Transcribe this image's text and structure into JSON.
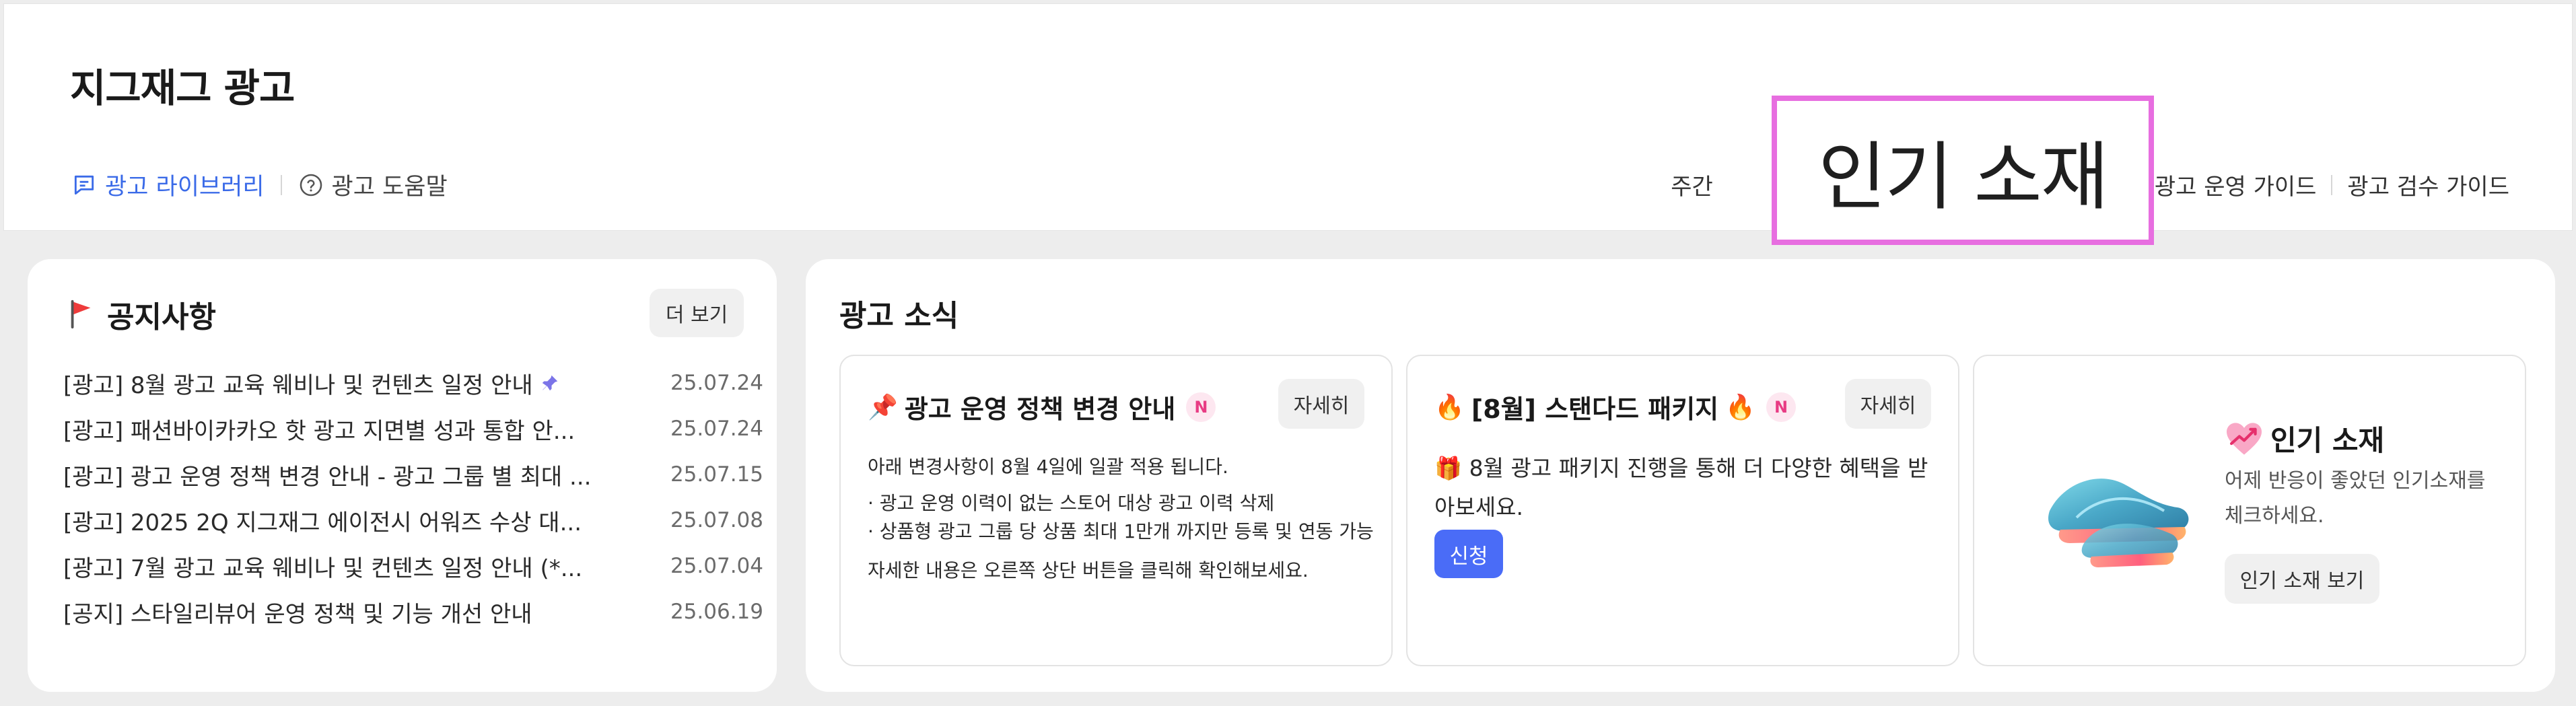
{
  "header": {
    "title": "지그재그 광고",
    "left_links": [
      {
        "label": "광고 라이브러리",
        "icon": "chat-list-icon"
      },
      {
        "label": "광고 도움말",
        "icon": "help-circle-icon"
      }
    ],
    "right_links": [
      "주간",
      "광고 운영 가이드",
      "광고 검수 가이드"
    ]
  },
  "overlay": {
    "label": "인기 소재"
  },
  "notice": {
    "title": "공지사항",
    "more_label": "더 보기",
    "items": [
      {
        "title": "[광고] 8월 광고 교육 웨비나 및 컨텐츠 일정 안내",
        "date": "25.07.24",
        "pinned": true
      },
      {
        "title": "[광고] 패션바이카카오 핫 광고 지면별 성과 통합 안...",
        "date": "25.07.24"
      },
      {
        "title": "[광고] 광고 운영 정책 변경 안내 - 광고 그룹 별 최대 ...",
        "date": "25.07.15"
      },
      {
        "title": "[광고] 2025 2Q 지그재그 에이전시 어워즈 수상 대...",
        "date": "25.07.08"
      },
      {
        "title": "[광고] 7월 광고 교육 웨비나 및 컨텐츠 일정 안내 (*...",
        "date": "25.07.04"
      },
      {
        "title": "[공지] 스타일리뷰어 운영 정책 및 기능 개선 안내",
        "date": "25.06.19"
      }
    ]
  },
  "news": {
    "title": "광고 소식",
    "card1": {
      "emoji": "📌",
      "title": "광고 운영 정책 변경 안내",
      "badge": "N",
      "detail_label": "자세히",
      "intro": "아래 변경사항이 8월 4일에 일괄 적용 됩니다.",
      "bullets": [
        "· 광고 운영 이력이 없는 스토어 대상 광고 이력 삭제",
        "· 상품형 광고 그룹 당 상품 최대 1만개 까지만 등록 및 연동 가능"
      ],
      "footer": "자세한 내용은 오른쪽 상단 버튼을 클릭해 확인해보세요."
    },
    "card2": {
      "emoji_left": "🔥",
      "title": "[8월] 스탠다드 패키지",
      "emoji_right": "🔥",
      "badge": "N",
      "detail_label": "자세히",
      "body_emoji": "🎁",
      "body": "8월 광고 패키지 진행을 통해 더 다양한 혜택을 받아보세요.",
      "apply_label": "신청"
    },
    "card3": {
      "title": "인기 소재",
      "desc": "어제 반응이 좋았던 인기소재를 체크하세요.",
      "button_label": "인기 소재 보기"
    }
  },
  "colors": {
    "accent": "#3b6be8",
    "primary_button": "#4a6cf7",
    "overlay_border": "#e76ee0",
    "badge_text": "#e83c84",
    "badge_bg": "#fde7f0"
  }
}
